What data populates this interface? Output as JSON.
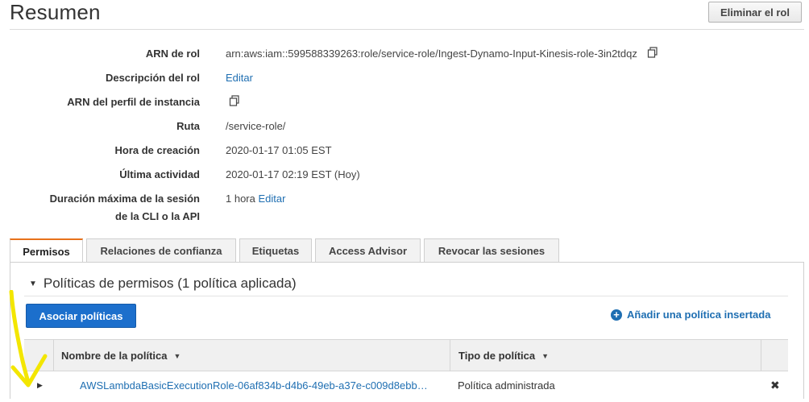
{
  "header": {
    "title": "Resumen",
    "delete_role_label": "Eliminar el rol"
  },
  "summary": {
    "arn": {
      "label": "ARN de rol",
      "value": "arn:aws:iam::599588339263:role/service-role/Ingest-Dynamo-Input-Kinesis-role-3in2tdqz",
      "icon": "copy-icon"
    },
    "description": {
      "label": "Descripción del rol",
      "link": "Editar"
    },
    "instance_profile": {
      "label": "ARN del perfil de instancia",
      "icon": "copy-icon"
    },
    "path": {
      "label": "Ruta",
      "value": "/service-role/"
    },
    "creation_time": {
      "label": "Hora de creación",
      "value": "2020-01-17 01:05 EST"
    },
    "last_activity": {
      "label": "Última actividad",
      "value": "2020-01-17 02:19 EST (Hoy)"
    },
    "max_session": {
      "label_line1": "Duración máxima de la sesión",
      "label_line2": "de la CLI o la API",
      "value": "1 hora",
      "link": "Editar"
    }
  },
  "tabs": [
    {
      "label": "Permisos",
      "active": true
    },
    {
      "label": "Relaciones de confianza",
      "active": false
    },
    {
      "label": "Etiquetas",
      "active": false
    },
    {
      "label": "Access Advisor",
      "active": false
    },
    {
      "label": "Revocar las sesiones",
      "active": false
    }
  ],
  "permissions": {
    "heading": "Políticas de permisos (1 política aplicada)",
    "attach_button": "Asociar políticas",
    "inline_policy_link": "Añadir una política insertada",
    "columns": [
      "Nombre de la política",
      "Tipo de política"
    ],
    "rows": [
      {
        "name": "AWSLambdaBasicExecutionRole-06af834b-d4b6-49eb-a37e-c009d8ebb…",
        "type": "Política administrada"
      }
    ]
  },
  "colors": {
    "accent_tab": "#e7711b",
    "primary_button": "#1c6fcc",
    "link": "#1f6fb2",
    "annotation_arrow": "#f3e600"
  }
}
